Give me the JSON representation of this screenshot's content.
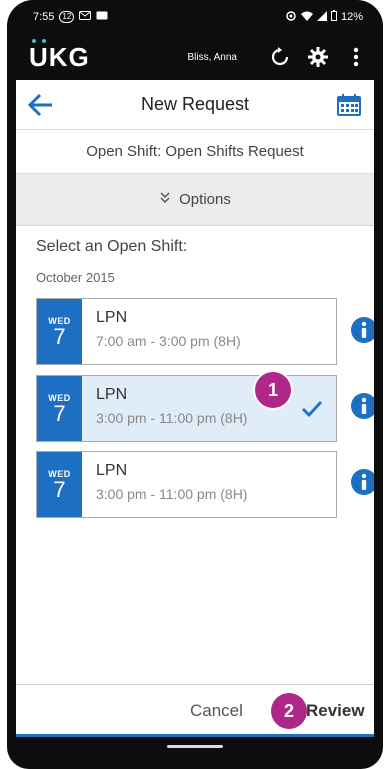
{
  "status_bar": {
    "time": "7:55",
    "notif_count": "12",
    "battery": "12%"
  },
  "app_bar": {
    "logo": "UKG",
    "user_name": "Bliss, Anna"
  },
  "header": {
    "title": "New Request"
  },
  "sub_header": {
    "title": "Open Shift: Open Shifts Request"
  },
  "options": {
    "label": "Options"
  },
  "content": {
    "select_title": "Select an Open Shift:",
    "month": "October 2015",
    "shifts": [
      {
        "dow": "WED",
        "day": "7",
        "role": "LPN",
        "time": "7:00 am - 3:00 pm (8H)",
        "selected": false
      },
      {
        "dow": "WED",
        "day": "7",
        "role": "LPN",
        "time": "3:00 pm - 11:00 pm (8H)",
        "selected": true
      },
      {
        "dow": "WED",
        "day": "7",
        "role": "LPN",
        "time": "3:00 pm - 11:00 pm (8H)",
        "selected": false
      }
    ]
  },
  "callouts": [
    "1",
    "2"
  ],
  "footer": {
    "cancel_label": "Cancel",
    "review_label": "Review"
  },
  "colors": {
    "accent_blue": "#1c6fc2",
    "callout_magenta": "#b0278a",
    "selected_bg": "#e0edf8"
  }
}
